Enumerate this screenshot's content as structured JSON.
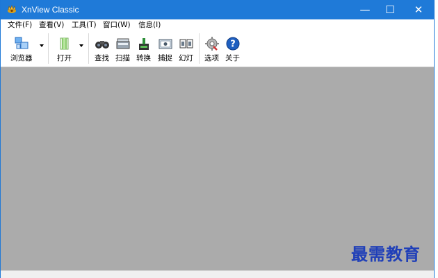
{
  "window": {
    "title": "XnView Classic",
    "app_icon": "xnview-app-icon",
    "controls": {
      "minimize": "—",
      "maximize": "☐",
      "close": "✕"
    }
  },
  "menubar": {
    "items": [
      {
        "label": "文件(F)"
      },
      {
        "label": "查看(V)"
      },
      {
        "label": "工具(T)"
      },
      {
        "label": "窗口(W)"
      },
      {
        "label": "信息(I)"
      }
    ]
  },
  "toolbar": {
    "buttons": [
      {
        "label": "浏览器",
        "icon": "browser-icon",
        "has_dropdown": true
      },
      {
        "label": "打开",
        "icon": "open-icon",
        "has_dropdown": true
      },
      {
        "label": "查找",
        "icon": "binoculars-icon"
      },
      {
        "label": "扫描",
        "icon": "scanner-icon"
      },
      {
        "label": "转换",
        "icon": "convert-icon"
      },
      {
        "label": "捕捉",
        "icon": "capture-icon"
      },
      {
        "label": "幻灯",
        "icon": "slideshow-icon"
      },
      {
        "label": "选项",
        "icon": "options-icon"
      },
      {
        "label": "关于",
        "icon": "about-icon"
      }
    ]
  },
  "watermark": {
    "text": "最需教育"
  },
  "colors": {
    "titlebar": "#1f7ad8",
    "content_bg": "#ababab",
    "watermark": "#1f3fb8"
  }
}
